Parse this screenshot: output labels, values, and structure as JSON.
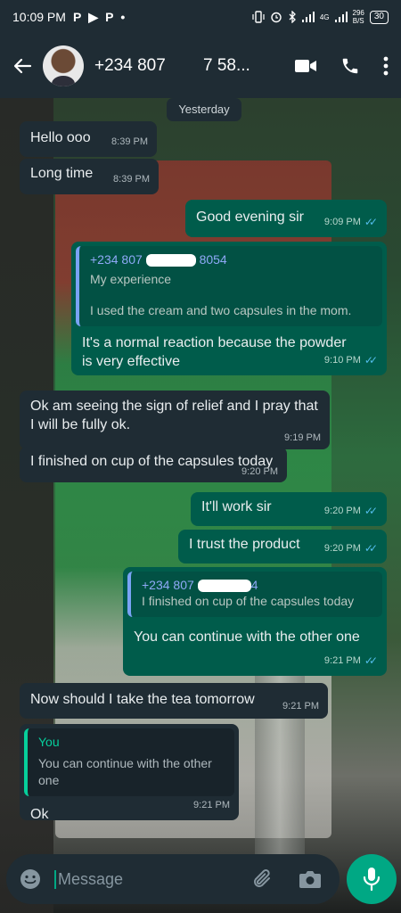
{
  "status_bar": {
    "time": "10:09 PM",
    "left_icons": [
      "P",
      "▶",
      "P",
      "•"
    ],
    "network": "4G",
    "net_speed_value": "296",
    "net_speed_unit": "B/S",
    "battery": "30"
  },
  "header": {
    "contact_name": "+234 807        7 58...",
    "icons": [
      "back-arrow-icon",
      "video-call-icon",
      "phone-icon",
      "more-vert-icon"
    ]
  },
  "chat": {
    "date_chip": "Yesterday",
    "messages": [
      {
        "dir": "in",
        "text": "Hello ooo",
        "time": "8:39 PM"
      },
      {
        "dir": "in",
        "text": "Long time",
        "time": "8:39 PM"
      },
      {
        "dir": "out",
        "text": "Good evening sir",
        "time": "9:09 PM"
      },
      {
        "dir": "out",
        "quote_author": "+234 807",
        "quote_author_tail": "8054",
        "quote_title": "My experience",
        "quote_text": "I used the cream and two capsules in the mom.",
        "text": "It's a normal reaction because the powder is very effective",
        "time": "9:10 PM"
      },
      {
        "dir": "in",
        "text": "Ok am seeing the sign of relief and I pray that I will be fully ok.",
        "time": "9:19 PM"
      },
      {
        "dir": "in",
        "text": "I finished on cup of the capsules today",
        "time": "9:20 PM"
      },
      {
        "dir": "out",
        "text": "It'll work sir",
        "time": "9:20 PM"
      },
      {
        "dir": "out",
        "text": "I trust the product",
        "time": "9:20 PM"
      },
      {
        "dir": "out",
        "quote_author": "+234 807",
        "quote_author_tail": "4",
        "quote_text": "I finished on cup of the capsules today",
        "text": "You can continue with the other one",
        "time": "9:21 PM"
      },
      {
        "dir": "in",
        "text": "Now should I take the tea tomorrow",
        "time": "9:21 PM"
      },
      {
        "dir": "in",
        "quote_author": "You",
        "quote_text": "You can continue with the other one",
        "text": "Ok",
        "time": "9:21 PM"
      }
    ]
  },
  "input": {
    "placeholder": "Message",
    "icons": [
      "emoji-icon",
      "attach-icon",
      "camera-icon",
      "mic-icon"
    ]
  },
  "colors": {
    "header_bg": "#1f2c34",
    "incoming_bubble": "#1f2c34",
    "outgoing_bubble": "#005c4b",
    "accent": "#00a884",
    "read_ticks": "#53bdeb"
  }
}
